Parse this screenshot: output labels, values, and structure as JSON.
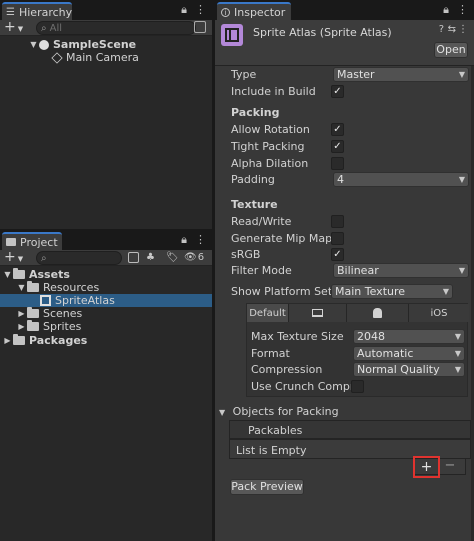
{
  "hierarchy": {
    "tab_label": "Hierarchy",
    "search_placeholder": "All",
    "items": [
      {
        "label": "SampleScene",
        "bold": true
      },
      {
        "label": "Main Camera",
        "bold": false
      }
    ]
  },
  "project": {
    "tab_label": "Project",
    "badge_count": "6",
    "tree": [
      {
        "label": "Assets",
        "bold": true
      },
      {
        "label": "Resources",
        "bold": false
      },
      {
        "label": "SpriteAtlas",
        "bold": false,
        "selected": true
      },
      {
        "label": "Scenes",
        "bold": false
      },
      {
        "label": "Sprites",
        "bold": false
      },
      {
        "label": "Packages",
        "bold": true
      }
    ]
  },
  "inspector": {
    "tab_label": "Inspector",
    "asset_title": "Sprite Atlas (Sprite Atlas)",
    "open_label": "Open",
    "type_label": "Type",
    "type_value": "Master",
    "include_label": "Include in Build",
    "include_checked": true,
    "packing_section": "Packing",
    "allow_rotation_label": "Allow Rotation",
    "allow_rotation_checked": true,
    "tight_packing_label": "Tight Packing",
    "tight_packing_checked": true,
    "alpha_dilation_label": "Alpha Dilation",
    "alpha_dilation_checked": false,
    "padding_label": "Padding",
    "padding_value": "4",
    "texture_section": "Texture",
    "read_write_label": "Read/Write",
    "read_write_checked": false,
    "mipmaps_label": "Generate Mip Maps",
    "mipmaps_checked": false,
    "srgb_label": "sRGB",
    "srgb_checked": true,
    "filter_label": "Filter Mode",
    "filter_value": "Bilinear",
    "show_platform_label": "Show Platform Settir",
    "show_platform_value": "Main Texture",
    "platform_tabs": [
      "Default",
      "",
      "",
      "iOS"
    ],
    "max_size_label": "Max Texture Size",
    "max_size_value": "2048",
    "format_label": "Format",
    "format_value": "Automatic",
    "compression_label": "Compression",
    "compression_value": "Normal Quality",
    "crunch_label": "Use Crunch Compres",
    "crunch_checked": false,
    "objects_label": "Objects for Packing",
    "packables_label": "Packables",
    "list_empty": "List is Empty",
    "add_label": "+",
    "remove_label": "−",
    "pack_preview_label": "Pack Preview"
  },
  "colors": {
    "highlight_red": "#e0332f",
    "selection_blue": "#2c5d87",
    "tab_accent": "#3a78c8"
  }
}
